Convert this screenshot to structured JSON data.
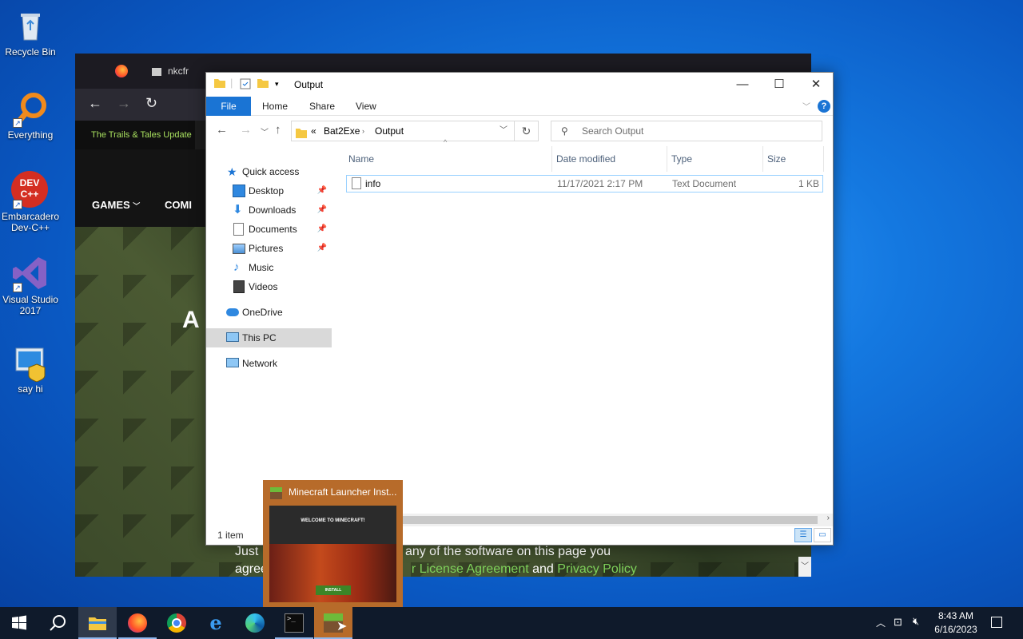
{
  "desktop": {
    "icons": [
      {
        "label": "Recycle Bin"
      },
      {
        "label": "Everything"
      },
      {
        "label": "Embarcadero Dev-C++",
        "glyph_text": "DEV C++"
      },
      {
        "label": "Visual Studio 2017"
      },
      {
        "label": "say hi"
      }
    ]
  },
  "browser": {
    "tab_title": "nkcfr",
    "banner": "The Trails & Tales Update",
    "menu": [
      "GAMES",
      "COMI"
    ],
    "hero_letter": "A",
    "footer": {
      "line1": "Just",
      "line1b": "ading any of the software on this page you",
      "line2": "agree",
      "link1": "r License Agreement",
      "and": "and",
      "link2": "Privacy Policy"
    }
  },
  "explorer": {
    "title": "Output",
    "ribbon_tabs": [
      "File",
      "Home",
      "Share",
      "View"
    ],
    "address": {
      "overflow": "«",
      "crumbs": [
        "Bat2Exe",
        "Output"
      ]
    },
    "search_placeholder": "Search Output",
    "nav": {
      "quick_access": "Quick access",
      "pinned": [
        {
          "label": "Desktop",
          "pinned": true
        },
        {
          "label": "Downloads",
          "pinned": true
        },
        {
          "label": "Documents",
          "pinned": true
        },
        {
          "label": "Pictures",
          "pinned": true
        },
        {
          "label": "Music",
          "pinned": false
        },
        {
          "label": "Videos",
          "pinned": false
        }
      ],
      "onedrive": "OneDrive",
      "this_pc": "This PC",
      "network": "Network"
    },
    "columns": [
      "Name",
      "Date modified",
      "Type",
      "Size"
    ],
    "files": [
      {
        "name": "info",
        "date": "11/17/2021 2:17 PM",
        "type": "Text Document",
        "size": "1 KB"
      }
    ],
    "status": "1 item"
  },
  "preview": {
    "title": "Minecraft Launcher Inst...",
    "heading": "WELCOME TO MINECRAFT!",
    "button": "INSTALL"
  },
  "taskbar": {
    "apps": [
      "start",
      "search",
      "file-explorer",
      "firefox",
      "chrome",
      "internet-explorer",
      "edge",
      "terminal",
      "minecraft"
    ],
    "time": "8:43 AM",
    "date": "6/16/2023"
  },
  "colors": {
    "accent": "#1a74d4",
    "preview_bg": "#b76b2a",
    "taskbar": "#0f1a2b"
  }
}
